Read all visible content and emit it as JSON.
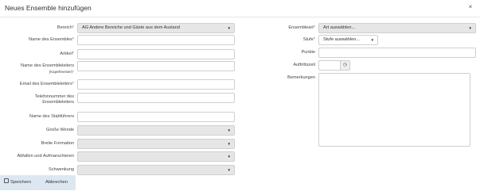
{
  "title": "Neues Ensemble hinzufügen",
  "close_glyph": "×",
  "left_fields": [
    {
      "label": "Bereich",
      "required": "*",
      "value": "AG Andere Bereiche und Gäste aus dem Ausland"
    },
    {
      "label": "Name des Ensembles",
      "required": "*"
    },
    {
      "label": "Artikel",
      "required": "*"
    },
    {
      "label": "Name des Ensembleleiters",
      "sub": "(Kapellmeister)",
      "required": "*"
    },
    {
      "label": "Email des Ensembleleiters",
      "required": "*"
    },
    {
      "label_line1": "Telefonnummer des",
      "label_line2": "Ensembleleiters"
    },
    {
      "label": "Name des Stabführers"
    },
    {
      "label": "Große Wende"
    },
    {
      "label": "Breite Formation"
    },
    {
      "label": "Abfallen und Aufmarschieren"
    },
    {
      "label": "Schwenkung"
    }
  ],
  "right_fields": {
    "ensembleart": {
      "label": "Ensembleart",
      "required": "*",
      "value": "Art auswählen..."
    },
    "stufe": {
      "label": "Stufe",
      "required": "*",
      "value": "Stufe auswählen..."
    },
    "punkte": {
      "label": "Punkte"
    },
    "auftrittszeit": {
      "label": "Auftrittszeit",
      "icon": "clock-icon",
      "glyph": "◷"
    },
    "bemerkungen": {
      "label": "Bemerkungen"
    }
  },
  "caret_glyph": "▼",
  "footer": {
    "save_label": "Speichern",
    "cancel_label": "Abbrechen"
  }
}
